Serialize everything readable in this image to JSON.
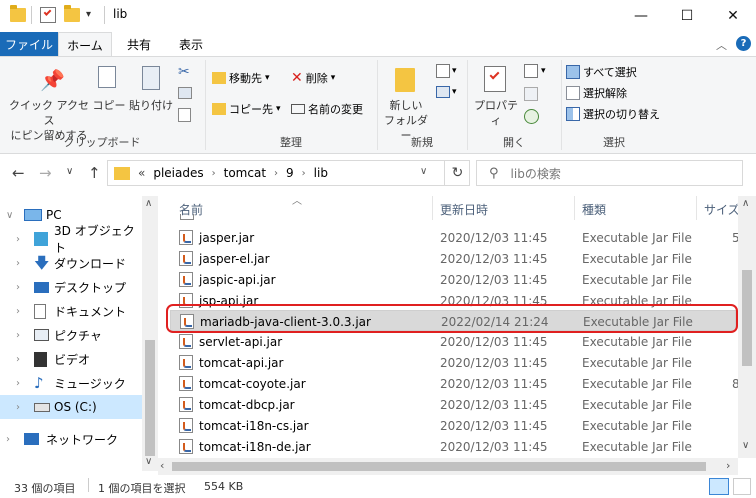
{
  "title": {
    "text": "lib",
    "qat_sep": "=",
    "minimize": "—",
    "maximize": "☐",
    "close": "✕"
  },
  "tabs": [
    "ファイル",
    "ホーム",
    "共有",
    "表示"
  ],
  "ribbon": {
    "clipboard": {
      "pin": "クイック アクセス\nにピン留めする",
      "copy": "コピー",
      "paste": "貼り付け",
      "group": "クリップボード"
    },
    "organize": {
      "move_to": "移動先",
      "copy_to": "コピー先",
      "delete": "削除",
      "rename": "名前の変更",
      "group": "整理"
    },
    "new": {
      "new_folder": "新しい\nフォルダー",
      "group": "新規"
    },
    "open": {
      "properties": "プロパティ",
      "group": "開く"
    },
    "select": {
      "select_all": "すべて選択",
      "select_none": "選択解除",
      "invert": "選択の切り替え",
      "group": "選択"
    }
  },
  "nav": {
    "back": "←",
    "forward": "→",
    "recent": "∨",
    "up": "↑",
    "breadcrumb": [
      "«",
      "pleiades",
      "tomcat",
      "9",
      "lib"
    ],
    "refresh": "↻",
    "search_placeholder": "libの検索"
  },
  "sidebar": [
    {
      "label": "PC",
      "icon": "pc-icon",
      "expanded": true
    },
    {
      "label": "3D オブジェクト",
      "icon": "3d-objects-icon"
    },
    {
      "label": "ダウンロード",
      "icon": "download-icon"
    },
    {
      "label": "デスクトップ",
      "icon": "desktop-icon"
    },
    {
      "label": "ドキュメント",
      "icon": "document-icon"
    },
    {
      "label": "ピクチャ",
      "icon": "pictures-icon"
    },
    {
      "label": "ビデオ",
      "icon": "video-icon"
    },
    {
      "label": "ミュージック",
      "icon": "music-icon"
    },
    {
      "label": "OS (C:)",
      "icon": "drive-icon",
      "selected": true
    },
    {
      "label": "ネットワーク",
      "icon": "network-icon"
    }
  ],
  "columns": {
    "name": "名前",
    "date": "更新日時",
    "type": "種類",
    "size": "サイズ"
  },
  "files": [
    {
      "name": "jasper.jar",
      "date": "2020/12/03 11:45",
      "type": "Executable Jar File",
      "size": "5"
    },
    {
      "name": "jasper-el.jar",
      "date": "2020/12/03 11:45",
      "type": "Executable Jar File",
      "size": ""
    },
    {
      "name": "jaspic-api.jar",
      "date": "2020/12/03 11:45",
      "type": "Executable Jar File",
      "size": ""
    },
    {
      "name": "jsp-api.jar",
      "date": "2020/12/03 11:45",
      "type": "Executable Jar File",
      "size": ""
    },
    {
      "name": "mariadb-java-client-3.0.3.jar",
      "date": "2022/02/14 21:24",
      "type": "Executable Jar File",
      "size": "",
      "selected": true
    },
    {
      "name": "servlet-api.jar",
      "date": "2020/12/03 11:45",
      "type": "Executable Jar File",
      "size": ""
    },
    {
      "name": "tomcat-api.jar",
      "date": "2020/12/03 11:45",
      "type": "Executable Jar File",
      "size": ""
    },
    {
      "name": "tomcat-coyote.jar",
      "date": "2020/12/03 11:45",
      "type": "Executable Jar File",
      "size": "8"
    },
    {
      "name": "tomcat-dbcp.jar",
      "date": "2020/12/03 11:45",
      "type": "Executable Jar File",
      "size": ""
    },
    {
      "name": "tomcat-i18n-cs.jar",
      "date": "2020/12/03 11:45",
      "type": "Executable Jar File",
      "size": ""
    },
    {
      "name": "tomcat-i18n-de.jar",
      "date": "2020/12/03 11:45",
      "type": "Executable Jar File",
      "size": ""
    }
  ],
  "status": {
    "count": "33 個の項目",
    "selected": "1 個の項目を選択",
    "size": "554 KB"
  },
  "colors": {
    "accent": "#1a6bb8",
    "highlight": "#e02020",
    "selected_row": "#d9d9d9",
    "selected_nav": "#cce8ff"
  }
}
